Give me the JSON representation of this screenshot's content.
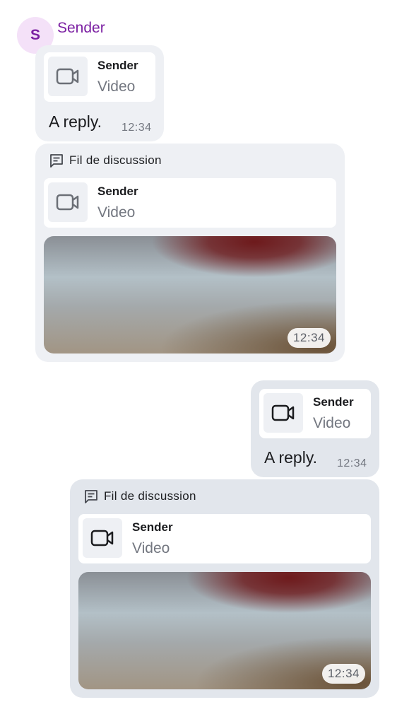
{
  "header": {
    "avatar_letter": "S",
    "sender_name": "Sender"
  },
  "messages": [
    {
      "reply_to": {
        "sender": "Sender",
        "type": "Video"
      },
      "body": "A reply.",
      "time": "12:34"
    },
    {
      "thread_label": "Fil de discussion",
      "reply_to": {
        "sender": "Sender",
        "type": "Video"
      },
      "video_time": "12:34"
    },
    {
      "reply_to": {
        "sender": "Sender",
        "type": "Video"
      },
      "body": "A reply.",
      "time": "12:34"
    },
    {
      "thread_label": "Fil de discussion",
      "reply_to": {
        "sender": "Sender",
        "type": "Video"
      },
      "video_time": "12:34"
    }
  ],
  "icons": {
    "reply_media": "video-camera-icon",
    "thread": "thread-icon"
  },
  "colors": {
    "sender": "#7b1fa2",
    "avatar_bg": "#f4e1f8",
    "incoming_bubble": "#eef0f4",
    "outgoing_bubble": "#e2e6ec"
  }
}
